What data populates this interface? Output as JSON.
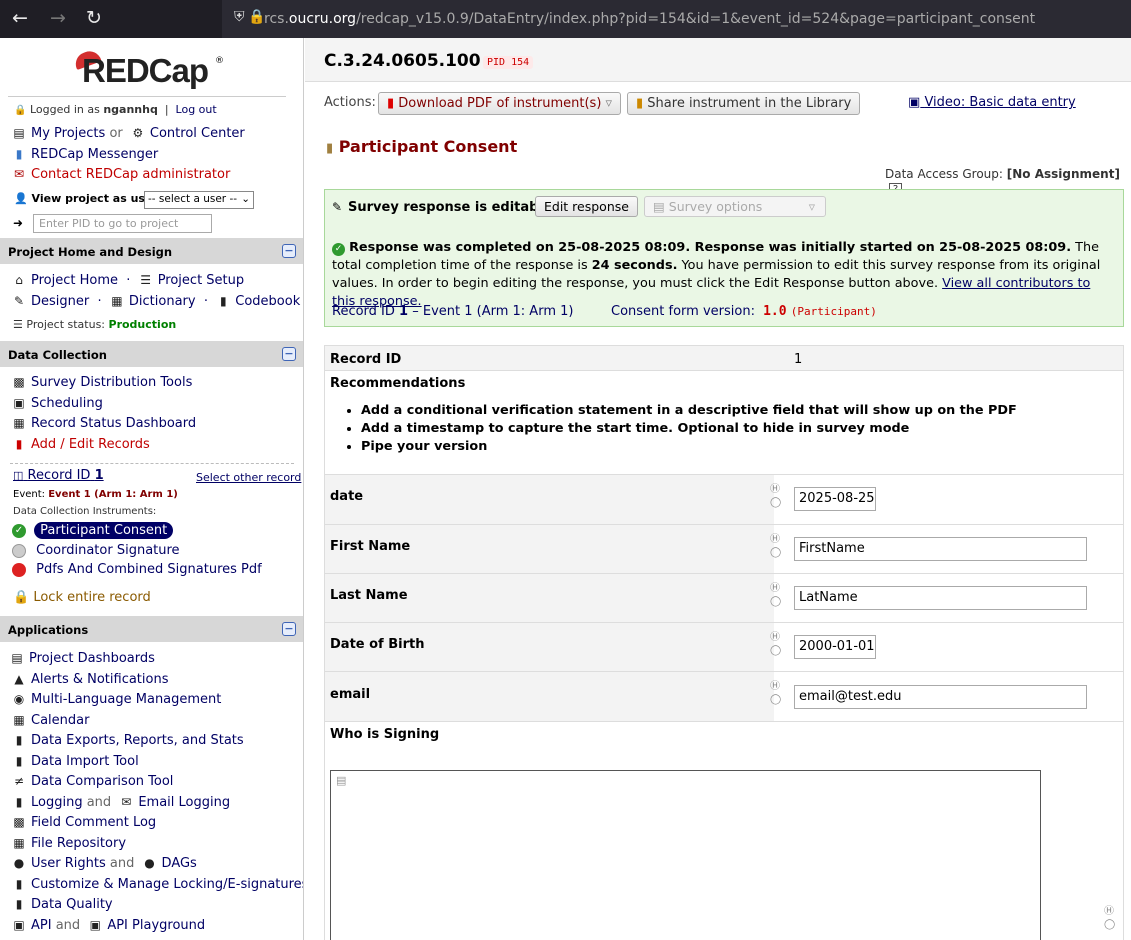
{
  "browser": {
    "url_prefix": "rcs.",
    "url_domain": "oucru.org",
    "url_suffix": "/redcap_v15.0.9/DataEntry/index.php?pid=154&id=1&event_id=524&page=participant_consent"
  },
  "sidebar": {
    "logo_text": "REDCap",
    "logged_in_label": "Logged in as",
    "username": "ngannhq",
    "logout": "Log out",
    "my_projects": "My Projects",
    "or": "or",
    "control_center": "Control Center",
    "messenger": "REDCap Messenger",
    "contact_admin": "Contact REDCap administrator",
    "view_as_label": "View project as user:",
    "view_as_select": "-- select a user --",
    "pid_placeholder": "Enter PID to go to project",
    "project_home_header": "Project Home and Design",
    "project_home": "Project Home",
    "project_setup": "Project Setup",
    "designer": "Designer",
    "dictionary": "Dictionary",
    "codebook": "Codebook",
    "status_label": "Project status:",
    "status_value": "Production",
    "data_collection_header": "Data Collection",
    "survey_dist": "Survey Distribution Tools",
    "scheduling": "Scheduling",
    "record_status": "Record Status Dashboard",
    "add_edit": "Add / Edit Records",
    "record_label": "Record ID",
    "record_id": "1",
    "select_other": "Select other record",
    "event_label": "Event:",
    "event_value": "Event 1 (Arm 1: Arm 1)",
    "instruments_label": "Data Collection Instruments:",
    "instruments": [
      "Participant Consent",
      "Coordinator Signature",
      "Pdfs And Combined Signatures Pdf"
    ],
    "lock_record": "Lock entire record",
    "applications_header": "Applications",
    "apps": [
      "Project Dashboards",
      "Alerts & Notifications",
      "Multi-Language Management",
      "Calendar",
      "Data Exports, Reports, and Stats",
      "Data Import Tool",
      "Data Comparison Tool"
    ],
    "logging": "Logging",
    "and": "and",
    "email_logging": "Email Logging",
    "field_comment": "Field Comment Log",
    "file_repo": "File Repository",
    "user_rights": "User Rights",
    "dags": "DAGs",
    "locking": "Customize & Manage Locking/E-signatures",
    "data_quality": "Data Quality",
    "api": "API",
    "api_playground": "API Playground"
  },
  "main": {
    "project_title": "C.3.24.0605.100",
    "pid_badge": "PID 154",
    "actions_label": "Actions:",
    "download_pdf": "Download PDF of instrument(s)",
    "share_library": "Share instrument in the Library",
    "video_link": "Video: Basic data entry",
    "form_title": "Participant Consent",
    "dag_label": "Data Access Group:",
    "dag_value": "[No Assignment]",
    "editable_label": "Survey response is editable",
    "edit_response": "Edit response",
    "survey_options": "Survey options",
    "completed_text": "Response was completed on 25-08-2025 08:09. Response was initially started on 25-08-2025 08:09.",
    "completion_text_1": "The total completion time of the response is",
    "completion_seconds": "24 seconds.",
    "completion_text_2": "You have permission to edit this survey response from its original values. In order to begin editing the response, you must click the Edit Response button above.",
    "view_contributors": "View all contributors to this response.",
    "record_line_label": "Record ID",
    "record_line_id": "1",
    "record_line_event": "– Event 1 (Arm 1: Arm 1)",
    "consent_version_label": "Consent form version:",
    "consent_version_value": "1.0",
    "consent_version_who": "(Participant)",
    "record_id_label": "Record ID",
    "record_id_value": "1",
    "recommendations_label": "Recommendations",
    "recommendations": [
      "Add a conditional verification statement in a descriptive field that will show up on the PDF",
      "Add a timestamp to capture the start time. Optional to hide in survey mode",
      "Pipe your version"
    ],
    "fields": [
      {
        "label": "date",
        "value": "2025-08-25"
      },
      {
        "label": "First Name",
        "value": "FirstName"
      },
      {
        "label": "Last Name",
        "value": "LatName"
      },
      {
        "label": "Date of Birth",
        "value": "2000-01-01"
      },
      {
        "label": "email",
        "value": "email@test.edu"
      }
    ],
    "who_signing_label": "Who is Signing"
  },
  "colors": {
    "link": "#000064",
    "form_title": "#800000",
    "green_bg": "#eaf7e5",
    "active_instrument": "#000066",
    "production": "#008000"
  }
}
